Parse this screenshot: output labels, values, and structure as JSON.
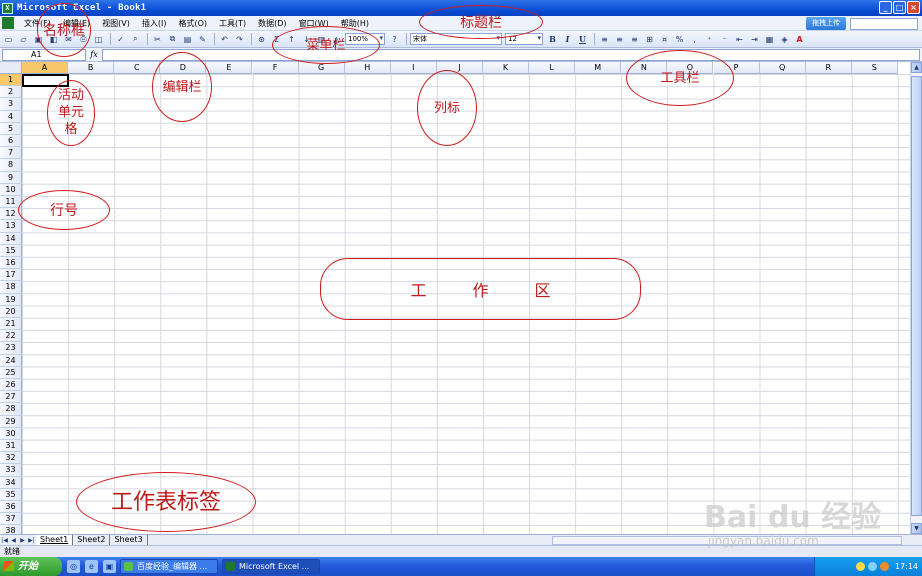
{
  "window": {
    "title": "Microsoft Excel - Book1",
    "controls": [
      "_",
      "□",
      "×"
    ]
  },
  "menu": {
    "items": [
      "文件(F)",
      "编辑(E)",
      "视图(V)",
      "插入(I)",
      "格式(O)",
      "工具(T)",
      "数据(D)",
      "窗口(W)",
      "帮助(H)"
    ],
    "upload_label": "拖拽上传"
  },
  "toolbar": {
    "zoom": "100%",
    "font_name": "宋体",
    "font_size": "12",
    "bold": "B",
    "italic": "I",
    "underline": "U",
    "percent": "%",
    "sum": "Σ",
    "fx": "fx"
  },
  "formula_bar": {
    "name_box": "A1"
  },
  "grid": {
    "columns": [
      "A",
      "B",
      "C",
      "D",
      "E",
      "F",
      "G",
      "H",
      "I",
      "J",
      "K",
      "L",
      "M",
      "N",
      "O",
      "P",
      "Q",
      "R",
      "S"
    ],
    "rows": [
      "1",
      "2",
      "3",
      "4",
      "5",
      "6",
      "7",
      "8",
      "9",
      "10",
      "11",
      "12",
      "13",
      "14",
      "15",
      "16",
      "17",
      "18",
      "19",
      "20",
      "21",
      "22",
      "23",
      "24",
      "25",
      "26",
      "27",
      "28",
      "29",
      "30",
      "31",
      "32",
      "33",
      "34",
      "35",
      "36",
      "37",
      "38"
    ],
    "active_cell": "A1"
  },
  "sheets": {
    "tabs": [
      "Sheet1",
      "Sheet2",
      "Sheet3"
    ],
    "active": "Sheet1"
  },
  "status": {
    "text": "就绪"
  },
  "taskbar": {
    "start_label": "开始",
    "tasks": [
      "百度经验_编辑器 ...",
      "Microsoft Excel ..."
    ],
    "clock": "17:14"
  },
  "annotations": {
    "name_box": "名称框",
    "title_bar": "标题栏",
    "menu_bar": "菜单栏",
    "edit_bar": "编辑栏",
    "active_cell": "活动单元格",
    "toolbar": "工具栏",
    "column_label": "列标",
    "row_number": "行号",
    "work_area": "工作区",
    "sheet_tabs": "工作表标签"
  },
  "watermark": {
    "brand": "Bai du 经验",
    "url": "jingyan.baidu.com"
  }
}
